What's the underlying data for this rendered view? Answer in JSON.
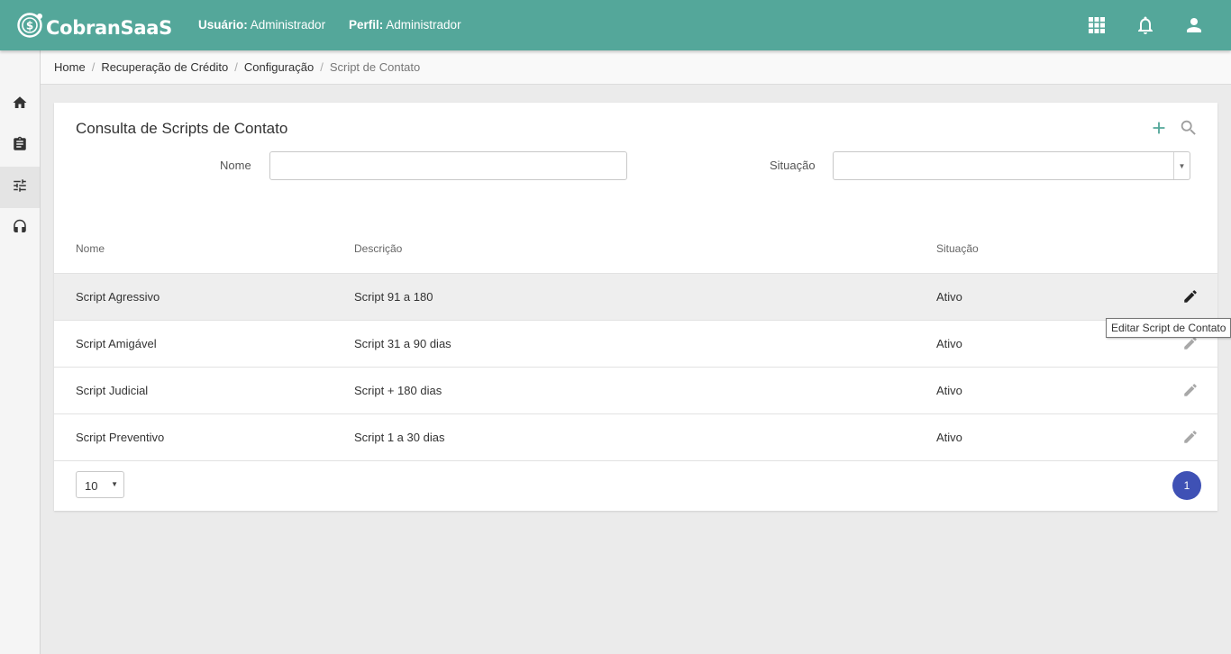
{
  "app": {
    "name": "CobranSaaS",
    "user_label": "Usuário:",
    "user_value": "Administrador",
    "profile_label": "Perfil:",
    "profile_value": "Administrador"
  },
  "topbar_icons": [
    "apps-grid-icon",
    "bell-icon",
    "account-icon"
  ],
  "sidebar": {
    "items": [
      {
        "icon": "home-icon",
        "active": false
      },
      {
        "icon": "clipboard-icon",
        "active": false
      },
      {
        "icon": "sliders-icon",
        "active": true
      },
      {
        "icon": "headset-icon",
        "active": false
      }
    ]
  },
  "breadcrumb": [
    "Home",
    "Recuperação de Crédito",
    "Configuração",
    "Script de Contato"
  ],
  "card": {
    "title": "Consulta de Scripts de Contato",
    "filters": {
      "nome_label": "Nome",
      "nome_value": "",
      "situacao_label": "Situação",
      "situacao_value": ""
    }
  },
  "table": {
    "columns": [
      "Nome",
      "Descrição",
      "Situação"
    ],
    "rows": [
      {
        "nome": "Script Agressivo",
        "descricao": "Script 91 a 180",
        "situacao": "Ativo"
      },
      {
        "nome": "Script Amigável",
        "descricao": "Script 31 a 90 dias",
        "situacao": "Ativo"
      },
      {
        "nome": "Script Judicial",
        "descricao": "Script + 180 dias",
        "situacao": "Ativo"
      },
      {
        "nome": "Script Preventivo",
        "descricao": "Script 1 a 30 dias",
        "situacao": "Ativo"
      }
    ]
  },
  "tooltip": "Editar Script de Contato",
  "pagination": {
    "page_size": "10",
    "current_page": "1"
  },
  "colors": {
    "topbar": "#54a79a",
    "accent": "#3f51b5",
    "add_icon": "#54a79a"
  }
}
